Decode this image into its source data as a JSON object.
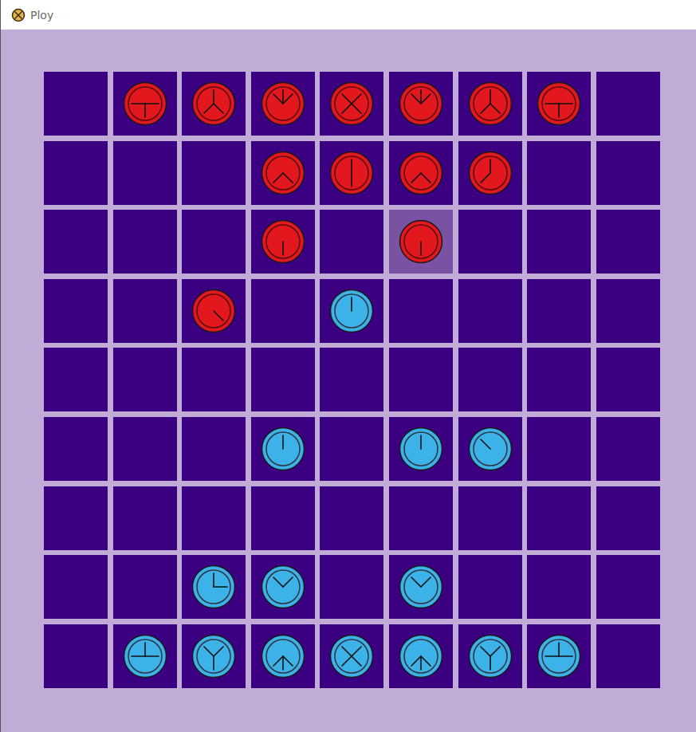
{
  "window": {
    "title": "Ploy"
  },
  "board": {
    "rows": [
      {
        "cells": [
          {
            "selected": false,
            "piece": null
          },
          {
            "selected": false,
            "piece": {
              "player": "red",
              "color": "#e3171e",
              "directions": [
                "W",
                "E",
                "S"
              ]
            }
          },
          {
            "selected": false,
            "piece": {
              "player": "red",
              "color": "#e3171e",
              "directions": [
                "N",
                "SW",
                "SE"
              ]
            }
          },
          {
            "selected": false,
            "piece": {
              "player": "red",
              "color": "#e3171e",
              "directions": [
                "N",
                "NW",
                "NE"
              ]
            }
          },
          {
            "selected": false,
            "piece": {
              "player": "red",
              "color": "#e3171e",
              "directions": [
                "NE",
                "NW",
                "SE",
                "SW"
              ]
            }
          },
          {
            "selected": false,
            "piece": {
              "player": "red",
              "color": "#e3171e",
              "directions": [
                "N",
                "NW",
                "NE"
              ]
            }
          },
          {
            "selected": false,
            "piece": {
              "player": "red",
              "color": "#e3171e",
              "directions": [
                "N",
                "SW",
                "SE"
              ]
            }
          },
          {
            "selected": false,
            "piece": {
              "player": "red",
              "color": "#e3171e",
              "directions": [
                "W",
                "E",
                "S"
              ]
            }
          },
          {
            "selected": false,
            "piece": null
          }
        ]
      },
      {
        "cells": [
          {
            "selected": false,
            "piece": null
          },
          {
            "selected": false,
            "piece": null
          },
          {
            "selected": false,
            "piece": null
          },
          {
            "selected": false,
            "piece": {
              "player": "red",
              "color": "#e3171e",
              "directions": [
                "SW",
                "SE"
              ]
            }
          },
          {
            "selected": false,
            "piece": {
              "player": "red",
              "color": "#e3171e",
              "directions": [
                "N",
                "S"
              ]
            }
          },
          {
            "selected": false,
            "piece": {
              "player": "red",
              "color": "#e3171e",
              "directions": [
                "SW",
                "SE"
              ]
            }
          },
          {
            "selected": false,
            "piece": {
              "player": "red",
              "color": "#e3171e",
              "directions": [
                "N",
                "SW"
              ]
            }
          },
          {
            "selected": false,
            "piece": null
          },
          {
            "selected": false,
            "piece": null
          }
        ]
      },
      {
        "cells": [
          {
            "selected": false,
            "piece": null
          },
          {
            "selected": false,
            "piece": null
          },
          {
            "selected": false,
            "piece": null
          },
          {
            "selected": false,
            "piece": {
              "player": "red",
              "color": "#e3171e",
              "directions": [
                "S"
              ]
            }
          },
          {
            "selected": false,
            "piece": null
          },
          {
            "selected": true,
            "piece": {
              "player": "red",
              "color": "#e3171e",
              "directions": [
                "S"
              ]
            }
          },
          {
            "selected": false,
            "piece": null
          },
          {
            "selected": false,
            "piece": null
          },
          {
            "selected": false,
            "piece": null
          }
        ]
      },
      {
        "cells": [
          {
            "selected": false,
            "piece": null
          },
          {
            "selected": false,
            "piece": null
          },
          {
            "selected": false,
            "piece": {
              "player": "red",
              "color": "#e3171e",
              "directions": [
                "SE"
              ]
            }
          },
          {
            "selected": false,
            "piece": null
          },
          {
            "selected": false,
            "piece": {
              "player": "blue",
              "color": "#3db2e8",
              "directions": [
                "N"
              ]
            }
          },
          {
            "selected": false,
            "piece": null
          },
          {
            "selected": false,
            "piece": null
          },
          {
            "selected": false,
            "piece": null
          },
          {
            "selected": false,
            "piece": null
          }
        ]
      },
      {
        "cells": [
          {
            "selected": false,
            "piece": null
          },
          {
            "selected": false,
            "piece": null
          },
          {
            "selected": false,
            "piece": null
          },
          {
            "selected": false,
            "piece": null
          },
          {
            "selected": false,
            "piece": null
          },
          {
            "selected": false,
            "piece": null
          },
          {
            "selected": false,
            "piece": null
          },
          {
            "selected": false,
            "piece": null
          },
          {
            "selected": false,
            "piece": null
          }
        ]
      },
      {
        "cells": [
          {
            "selected": false,
            "piece": null
          },
          {
            "selected": false,
            "piece": null
          },
          {
            "selected": false,
            "piece": null
          },
          {
            "selected": false,
            "piece": {
              "player": "blue",
              "color": "#3db2e8",
              "directions": [
                "N"
              ]
            }
          },
          {
            "selected": false,
            "piece": null
          },
          {
            "selected": false,
            "piece": {
              "player": "blue",
              "color": "#3db2e8",
              "directions": [
                "N"
              ]
            }
          },
          {
            "selected": false,
            "piece": {
              "player": "blue",
              "color": "#3db2e8",
              "directions": [
                "NW"
              ]
            }
          },
          {
            "selected": false,
            "piece": null
          },
          {
            "selected": false,
            "piece": null
          }
        ]
      },
      {
        "cells": [
          {
            "selected": false,
            "piece": null
          },
          {
            "selected": false,
            "piece": null
          },
          {
            "selected": false,
            "piece": null
          },
          {
            "selected": false,
            "piece": null
          },
          {
            "selected": false,
            "piece": null
          },
          {
            "selected": false,
            "piece": null
          },
          {
            "selected": false,
            "piece": null
          },
          {
            "selected": false,
            "piece": null
          },
          {
            "selected": false,
            "piece": null
          }
        ]
      },
      {
        "cells": [
          {
            "selected": false,
            "piece": null
          },
          {
            "selected": false,
            "piece": null
          },
          {
            "selected": false,
            "piece": {
              "player": "blue",
              "color": "#3db2e8",
              "directions": [
                "N",
                "E"
              ]
            }
          },
          {
            "selected": false,
            "piece": {
              "player": "blue",
              "color": "#3db2e8",
              "directions": [
                "NW",
                "NE"
              ]
            }
          },
          {
            "selected": false,
            "piece": null
          },
          {
            "selected": false,
            "piece": {
              "player": "blue",
              "color": "#3db2e8",
              "directions": [
                "NW",
                "NE"
              ]
            }
          },
          {
            "selected": false,
            "piece": null
          },
          {
            "selected": false,
            "piece": null
          },
          {
            "selected": false,
            "piece": null
          }
        ]
      },
      {
        "cells": [
          {
            "selected": false,
            "piece": null
          },
          {
            "selected": false,
            "piece": {
              "player": "blue",
              "color": "#3db2e8",
              "directions": [
                "W",
                "E",
                "N"
              ]
            }
          },
          {
            "selected": false,
            "piece": {
              "player": "blue",
              "color": "#3db2e8",
              "directions": [
                "NW",
                "NE",
                "S"
              ]
            }
          },
          {
            "selected": false,
            "piece": {
              "player": "blue",
              "color": "#3db2e8",
              "directions": [
                "S",
                "SW",
                "SE"
              ]
            }
          },
          {
            "selected": false,
            "piece": {
              "player": "blue",
              "color": "#3db2e8",
              "directions": [
                "NE",
                "NW",
                "SE",
                "SW"
              ]
            }
          },
          {
            "selected": false,
            "piece": {
              "player": "blue",
              "color": "#3db2e8",
              "directions": [
                "S",
                "SW",
                "SE"
              ]
            }
          },
          {
            "selected": false,
            "piece": {
              "player": "blue",
              "color": "#3db2e8",
              "directions": [
                "NW",
                "NE",
                "S"
              ]
            }
          },
          {
            "selected": false,
            "piece": {
              "player": "blue",
              "color": "#3db2e8",
              "directions": [
                "W",
                "E",
                "N"
              ]
            }
          },
          {
            "selected": false,
            "piece": null
          }
        ]
      }
    ]
  }
}
